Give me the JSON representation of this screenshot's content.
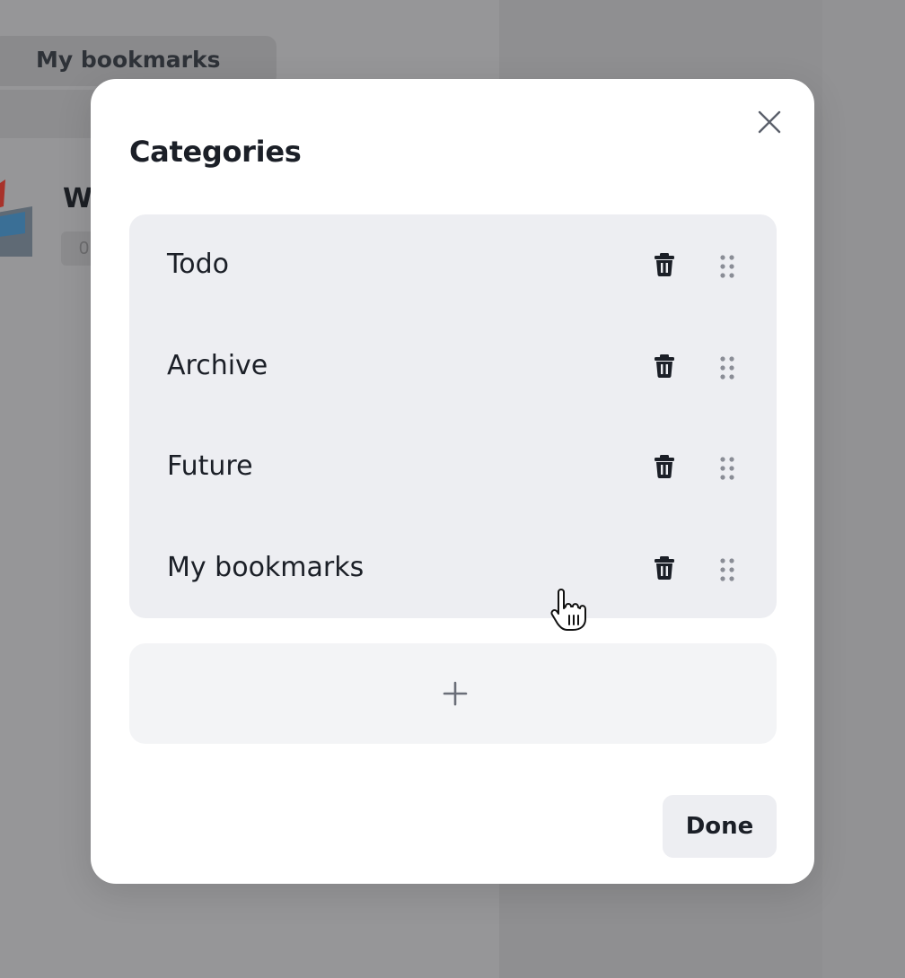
{
  "background": {
    "tab_label": "My bookmarks",
    "item_title": "W",
    "item_badge": "0"
  },
  "modal": {
    "title": "Categories",
    "close_icon": "close-icon",
    "categories": [
      {
        "label": "Todo"
      },
      {
        "label": "Archive"
      },
      {
        "label": "Future"
      },
      {
        "label": "My bookmarks"
      }
    ],
    "row_icons": [
      "trash-icon",
      "drag-handle-icon"
    ],
    "add_icon": "plus-icon",
    "done_label": "Done"
  },
  "colors": {
    "overlay": "#8f8f91",
    "modal_bg": "#ffffff",
    "list_bg": "#edeef2",
    "add_bg": "#f3f4f6",
    "text": "#1b1f27",
    "icon_muted": "#8a8d96"
  }
}
